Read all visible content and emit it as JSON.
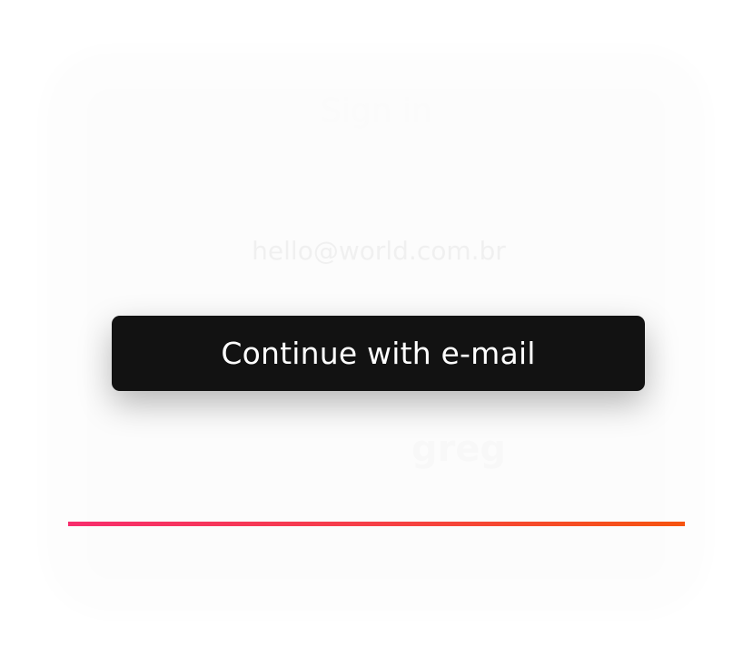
{
  "signin": {
    "title": "Sign in",
    "email_placeholder": "hello@world.com.br",
    "continue_label": "Continue with e-mail",
    "secondary_text": "greg"
  },
  "colors": {
    "button_bg": "#121212",
    "button_text": "#ffffff",
    "gradient_start": "#f72d6d",
    "gradient_end": "#f6540f"
  }
}
